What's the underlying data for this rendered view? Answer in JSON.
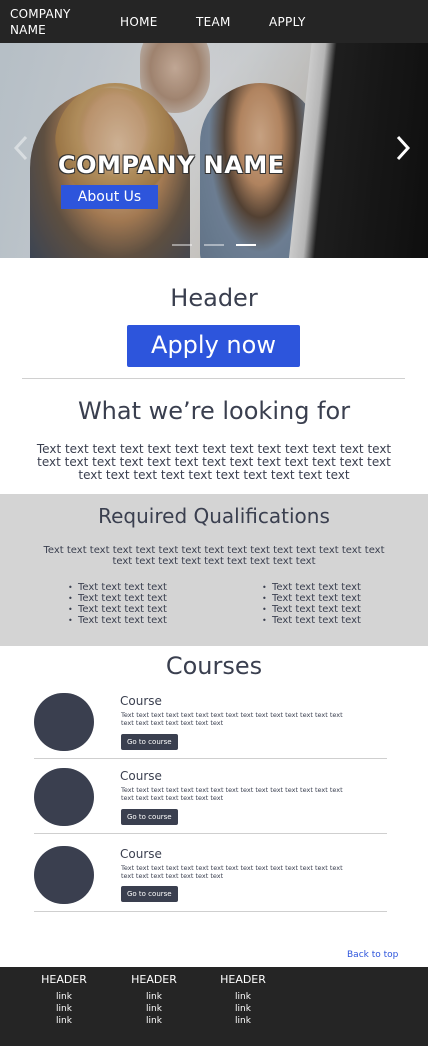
{
  "navbar": {
    "brand": "COMPANY NAME",
    "links": [
      "HOME",
      "TEAM",
      "APPLY"
    ]
  },
  "hero": {
    "title": "COMPANY NAME",
    "button": "About Us",
    "slides_total": 3,
    "active_slide": 3
  },
  "intro": {
    "header": "Header",
    "apply_button": "Apply now"
  },
  "looking": {
    "title": "What we’re looking for",
    "text": "Text text text text text text text text text text text text text text text text text text text text text text text text text text text text text text text text text text text text"
  },
  "qualifications": {
    "title": "Required Qualifications",
    "text": "Text text text text text text text text text text text text text text text text text text text text text text text text",
    "left_items": [
      "Text text text text",
      "Text text text text",
      "Text text text text",
      "Text text text text"
    ],
    "right_items": [
      "Text text text text",
      "Text text text text",
      "Text text text text",
      "Text text text text"
    ]
  },
  "courses": {
    "title": "Courses",
    "items": [
      {
        "title": "Course",
        "desc": "Text text text text text text text text text text text text text text text text text text text text text text",
        "button": "Go to course"
      },
      {
        "title": "Course",
        "desc": "Text text text text text text text text text text text text text text text text text text text text text text",
        "button": "Go to course"
      },
      {
        "title": "Course",
        "desc": "Text text text text text text text text text text text text text text text text text text text text text text",
        "button": "Go to course"
      }
    ]
  },
  "back_to_top": "Back to top",
  "footer": {
    "columns": [
      {
        "header": "HEADER",
        "links": [
          "link",
          "link",
          "link"
        ]
      },
      {
        "header": "HEADER",
        "links": [
          "link",
          "link",
          "link"
        ]
      },
      {
        "header": "HEADER",
        "links": [
          "link",
          "link",
          "link"
        ]
      }
    ]
  },
  "colors": {
    "dark_bar": "#252525",
    "accent_blue": "#2d55dc",
    "text_dark": "#3a3f4f",
    "gray_band": "#d4d4d4"
  },
  "icons": {
    "carousel_prev": "chevron-left-icon",
    "carousel_next": "chevron-right-icon"
  }
}
